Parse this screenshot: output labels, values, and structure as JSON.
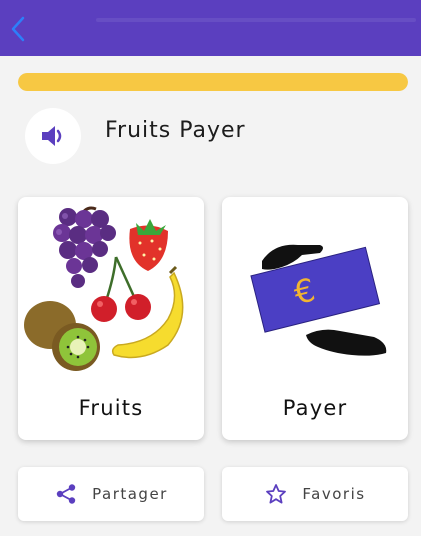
{
  "header": {
    "back_icon": "chevron-left-icon"
  },
  "progress": {
    "value": 1.0,
    "color": "#f7c843"
  },
  "phrase": {
    "title": "Fruits Payer",
    "audio_icon": "speaker-icon"
  },
  "cards": [
    {
      "label": "Fruits",
      "image": "fruits-illustration"
    },
    {
      "label": "Payer",
      "image": "euro-payment-illustration"
    }
  ],
  "actions": {
    "share_label": "Partager",
    "share_icon": "share-icon",
    "favorite_label": "Favoris",
    "favorite_icon": "star-icon"
  },
  "colors": {
    "accent": "#5b3fbf",
    "progress": "#f7c843"
  }
}
